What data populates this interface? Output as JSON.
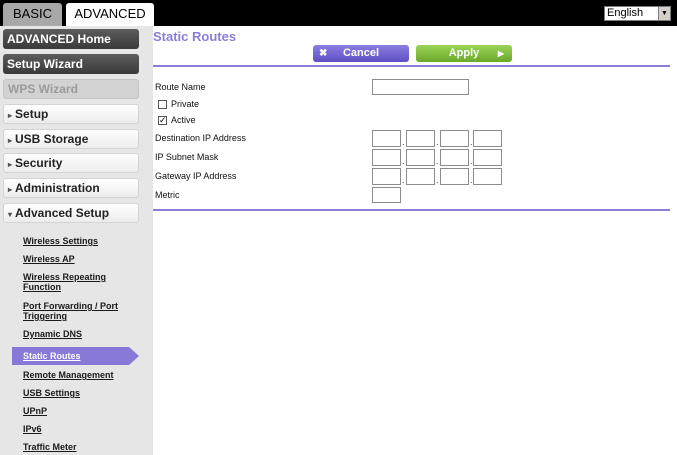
{
  "tabs": {
    "basic": "BASIC",
    "advanced": "ADVANCED"
  },
  "language": {
    "selected": "English"
  },
  "sidebar": {
    "advanced_home": "ADVANCED Home",
    "setup_wizard": "Setup Wizard",
    "wps_wizard": "WPS Wizard",
    "setup": "Setup",
    "usb_storage": "USB Storage",
    "security": "Security",
    "administration": "Administration",
    "advanced_setup": "Advanced Setup",
    "links": {
      "wireless_settings": "Wireless Settings",
      "wireless_ap": "Wireless AP",
      "wireless_repeating_1": "Wireless Repeating",
      "wireless_repeating_2": "Function",
      "port_forwarding_1": "Port Forwarding / Port",
      "port_forwarding_2": "Triggering",
      "dynamic_dns": "Dynamic DNS",
      "static_routes": "Static Routes",
      "remote_management": "Remote Management",
      "usb_settings": "USB Settings",
      "upnp": "UPnP",
      "ipv6": "IPv6",
      "traffic_meter": "Traffic Meter"
    }
  },
  "main": {
    "title": "Static Routes",
    "cancel_label": "Cancel",
    "apply_label": "Apply",
    "route_name_label": "Route Name",
    "private_label": "Private",
    "private_checked": false,
    "active_label": "Active",
    "active_checked": true,
    "destination_ip_label": "Destination IP Address",
    "subnet_mask_label": "IP Subnet Mask",
    "gateway_ip_label": "Gateway IP Address",
    "metric_label": "Metric",
    "ip_separator": "."
  },
  "colors": {
    "accent": "#8a7fd8",
    "apply": "#7fbf3a",
    "cancel": "#6a5acd"
  }
}
